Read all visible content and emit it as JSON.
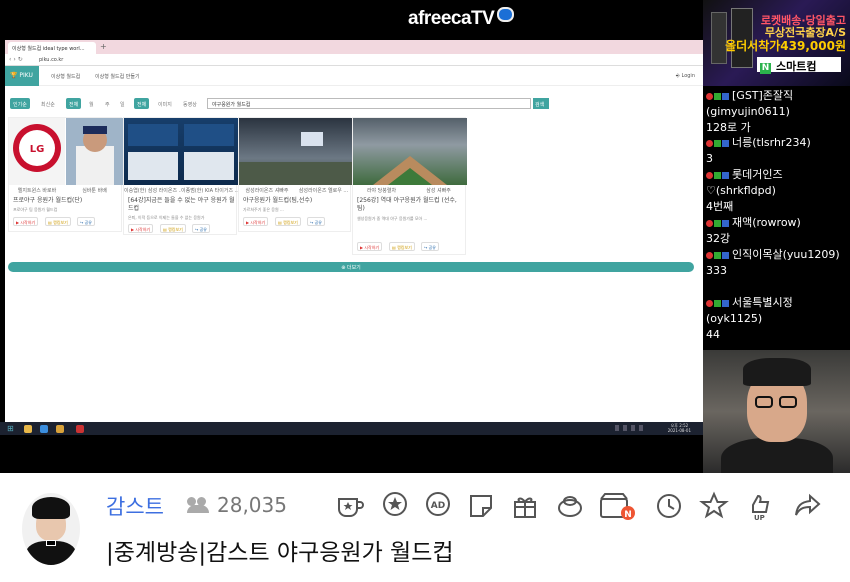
{
  "header": {
    "logo": "afreecaTV"
  },
  "browser": {
    "tab_title": "이상형 월드컵 ideal type worl...",
    "url": "piku.co.kr",
    "brand": "PIKU",
    "nav": [
      "이상형 월드컵",
      "이상형 월드컵 만들기"
    ],
    "login": "Login",
    "filters1": [
      "인기순",
      "최신순"
    ],
    "filters2": [
      "전체",
      "월",
      "주",
      "일"
    ],
    "filters3": [
      "전체",
      "이미지",
      "동영상"
    ],
    "search_value": "야구응원가 월드컵",
    "search_button": "검색",
    "more": "더보기",
    "cards": [
      {
        "caps": [
          "엘지트윈스 바로바",
          "심바툰 바배"
        ],
        "title": "프로야구 응원가 월드컵(단)",
        "desc": "프로야구 팀 응원가 월드컵",
        "btn1": "시작하기",
        "btn2": "랭킹보기",
        "btn3": "공유"
      },
      {
        "caps": [
          "이승엽(한) 삼성 라이온즈 ...",
          "이종범(한) KIA 타이거즈 ..."
        ],
        "title": "[64강]지금은 들을 수 없는 야구 응원가 월드컵",
        "desc": "은퇴, 이적 등으로 이제는 들을 수 없는 응원가",
        "btn1": "시작하기",
        "btn2": "랭킹보기",
        "btn3": "공유"
      },
      {
        "caps": [
          "삼성라이온즈 셔빠주",
          "삼성라이온즈 엘로우 ..."
        ],
        "title": "야구응원가 월드컵(팀,선수)",
        "desc": "가르쳐주기 좋은 응원 ...",
        "btn1": "시작하기",
        "btn2": "랭킹보기",
        "btn3": "공유"
      },
      {
        "caps": [
          "라야 당붕렬차",
          "삼성 셔빠주"
        ],
        "title": "[256강] 역대 야구응원가 월드컵 (선수, 팀)",
        "desc": "셀성응원가 중 역대 야구 응원가를 모아 ...",
        "btn1": "시작하기",
        "btn2": "랭킹보기",
        "btn3": "공유"
      }
    ],
    "clock_time": "오후 2:52",
    "clock_date": "2021-08-01"
  },
  "ad": {
    "line1": "로켓배송·당일출고",
    "line2": "무상전국출장A/S",
    "line3": "올더서착가439,000원",
    "shop": "스마트컴",
    "shop_badge": "N"
  },
  "chat": [
    {
      "user": "[GST]존잘직(gimyujin0611)",
      "text": "128로 가"
    },
    {
      "user": "너릉(tlsrhr234)",
      "text": "3"
    },
    {
      "user": "롯데거인즈♡(shrkfldpd)",
      "text": "4번째"
    },
    {
      "user": "재액(rowrow)",
      "text": "32강"
    },
    {
      "user": "인직이목살(yuu1209)",
      "text": "333"
    },
    {
      "user": "서울특별시정(oyk1125)",
      "text": "44"
    }
  ],
  "broadcast": {
    "streamer": "감스트",
    "viewers": "28,035",
    "title": "|중계방송|감스트 야구응원가 월드컵"
  },
  "colors": {
    "accent": "#40a4a0",
    "streamer": "#3d6fe0",
    "chat_bg": "#000000"
  }
}
